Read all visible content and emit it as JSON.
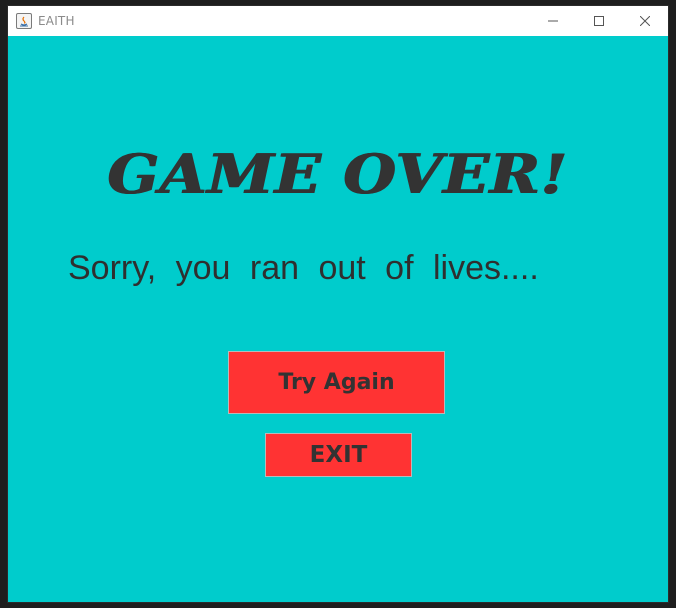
{
  "window": {
    "title": "EAITH",
    "controls": {
      "minimize_icon": "minimize-icon",
      "maximize_icon": "maximize-icon",
      "close_icon": "close-icon"
    }
  },
  "colors": {
    "background": "#00cccc",
    "text": "#333333",
    "button": "#ff3333",
    "titlebar": "#ffffff"
  },
  "game_over": {
    "heading": "GAME OVER!",
    "message": "Sorry, you ran out of lives....",
    "try_again_label": "Try Again",
    "exit_label": "EXIT"
  }
}
